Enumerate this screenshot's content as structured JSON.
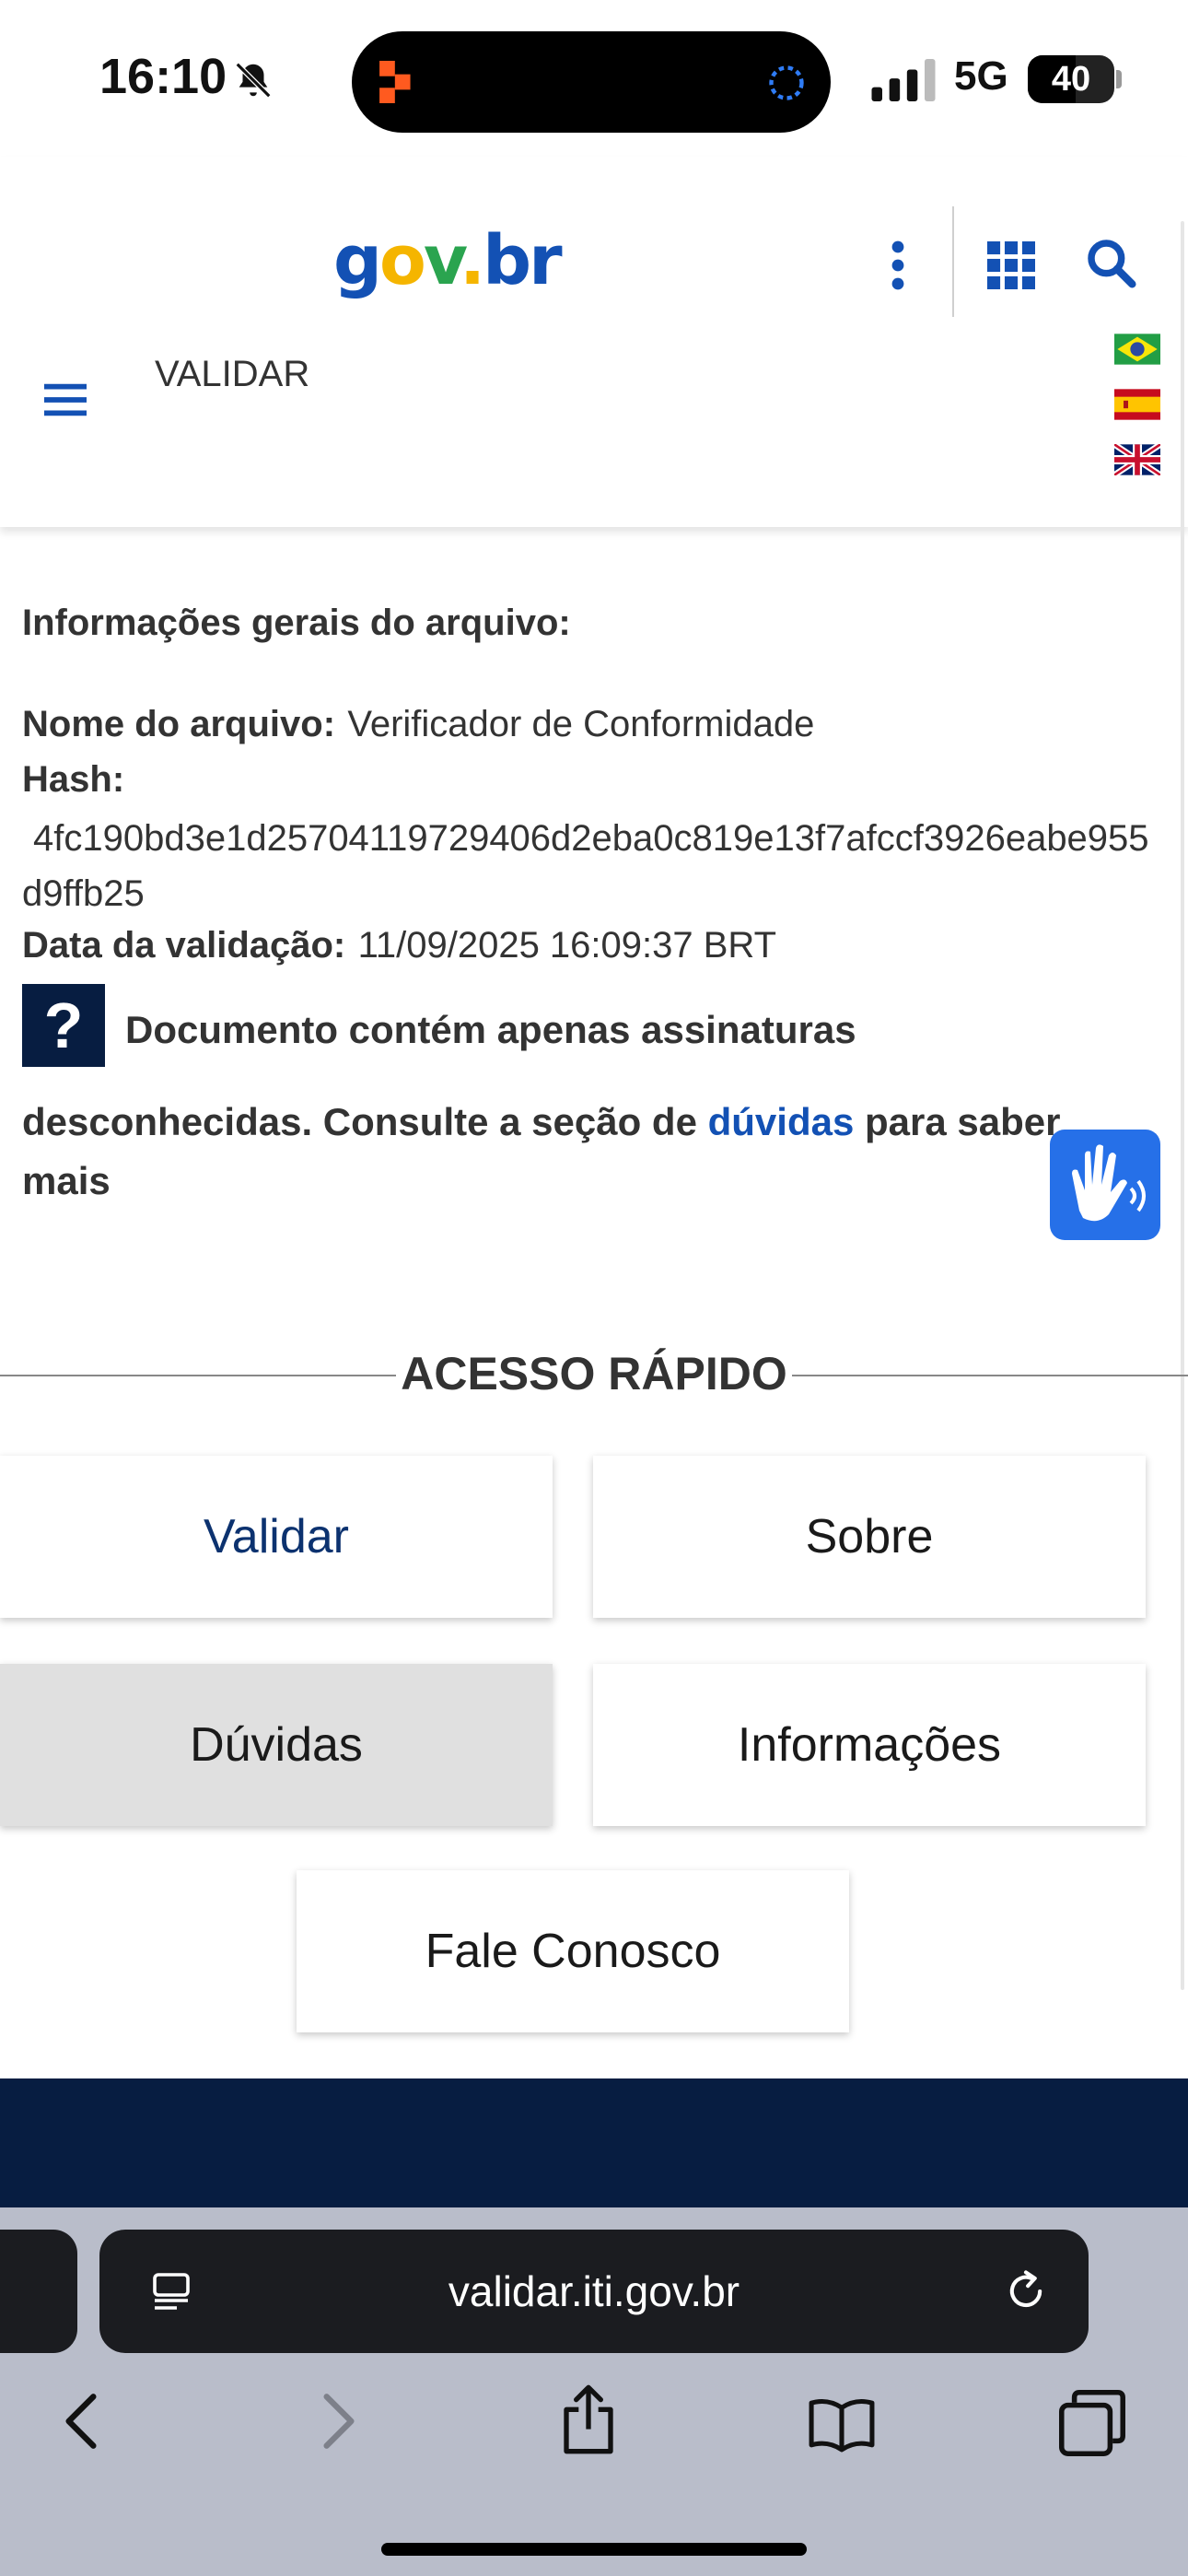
{
  "status_bar": {
    "time": "16:10",
    "network": "5G",
    "battery": "40"
  },
  "header": {
    "logo": {
      "g": "g",
      "o": "o",
      "v": "v",
      "dot": ".",
      "br": "br"
    },
    "nav_title": "VALIDAR"
  },
  "info": {
    "heading": "Informações gerais do arquivo:",
    "file_name_label": "Nome do arquivo:",
    "file_name_value": "Verificador de Conformidade",
    "hash_label": "Hash:",
    "hash_value": "4fc190bd3e1d25704119729406d2eba0c819e13f7afccf3926eabe955d9ffb25",
    "date_label": "Data da validação:",
    "date_value": "11/09/2025 16:09:37 BRT",
    "status_icon": "?",
    "status_line1": "Documento contém apenas assinaturas",
    "status_line2_prefix": "desconhecidas. Consulte a seção de",
    "status_link": "dúvidas",
    "status_line2_suffix": "para saber mais"
  },
  "quick_access": {
    "title": "ACESSO RÁPIDO",
    "buttons": [
      "Validar",
      "Sobre",
      "Dúvidas",
      "Informações",
      "Fale Conosco"
    ]
  },
  "safari": {
    "url": "validar.iti.gov.br"
  },
  "colors": {
    "brand_blue": "#1351b4",
    "navy": "#071d41",
    "logo_yellow": "#f5b500",
    "logo_green": "#2aa44f",
    "vlibras_blue": "#2670e8"
  }
}
